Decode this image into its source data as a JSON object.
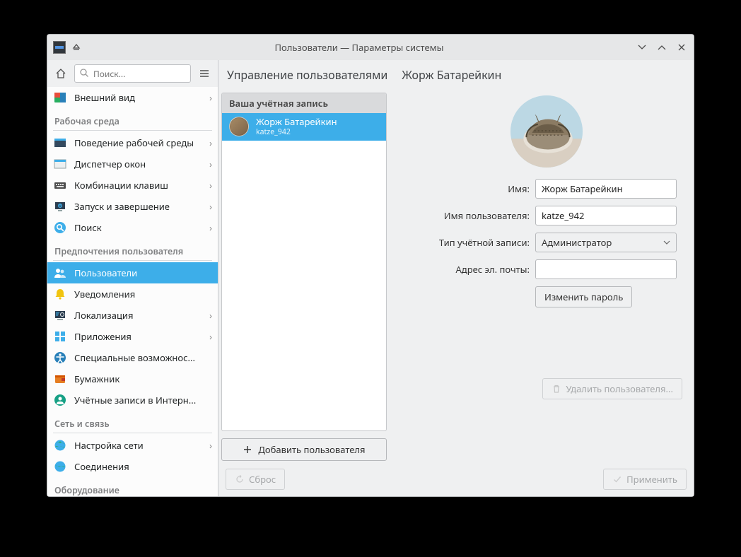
{
  "window": {
    "title": "Пользователи — Параметры системы"
  },
  "search": {
    "placeholder": "Поиск..."
  },
  "sidebar": {
    "top_item": {
      "label": "Внешний вид"
    },
    "cat_workspace": "Рабочая среда",
    "workspace": [
      {
        "label": "Поведение рабочей среды"
      },
      {
        "label": "Диспетчер окон"
      },
      {
        "label": "Комбинации клавиш"
      },
      {
        "label": "Запуск и завершение"
      },
      {
        "label": "Поиск"
      }
    ],
    "cat_userpref": "Предпочтения пользователя",
    "userpref": [
      {
        "label": "Пользователи"
      },
      {
        "label": "Уведомления"
      },
      {
        "label": "Локализация"
      },
      {
        "label": "Приложения"
      },
      {
        "label": "Специальные возможнос..."
      },
      {
        "label": "Бумажник"
      },
      {
        "label": "Учётные записи в Интерн..."
      }
    ],
    "cat_net": "Сеть и связь",
    "net": [
      {
        "label": "Настройка сети"
      },
      {
        "label": "Соединения"
      }
    ],
    "cat_hw": "Оборудование"
  },
  "breadcrumb": {
    "a": "Управление пользователями",
    "b": "Жорж Батарейкин"
  },
  "userlist": {
    "header": "Ваша учётная запись",
    "items": [
      {
        "display": "Жорж Батарейкин",
        "login": "katze_942"
      }
    ]
  },
  "add_user": "Добавить пользователя",
  "form": {
    "name_label": "Имя:",
    "name_value": "Жорж Батарейкин",
    "username_label": "Имя пользователя:",
    "username_value": "katze_942",
    "type_label": "Тип учётной записи:",
    "type_value": "Администратор",
    "email_label": "Адрес эл. почты:",
    "email_value": "",
    "change_pw": "Изменить пароль",
    "delete_user": "Удалить пользователя..."
  },
  "footer": {
    "reset": "Сброс",
    "apply": "Применить"
  }
}
